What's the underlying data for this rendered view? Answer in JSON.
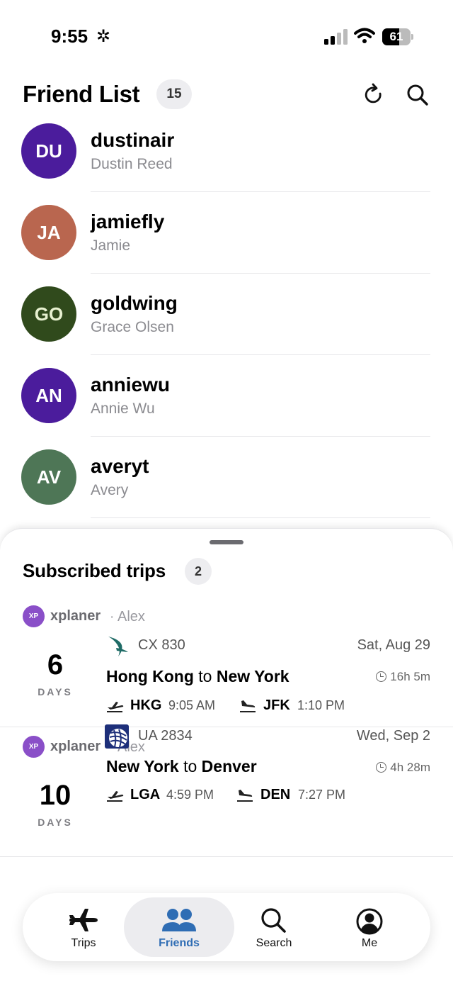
{
  "status_bar": {
    "time": "9:55",
    "battery_level": 61,
    "battery_text": "61"
  },
  "header": {
    "title": "Friend List",
    "count": "15"
  },
  "friends": [
    {
      "initials": "DU",
      "username": "dustinair",
      "name": "Dustin Reed",
      "color": "#4b1c9c"
    },
    {
      "initials": "JA",
      "username": "jamiefly",
      "name": "Jamie",
      "color": "#b9664f"
    },
    {
      "initials": "GO",
      "username": "goldwing",
      "name": "Grace Olsen",
      "color": "#304a1c"
    },
    {
      "initials": "AN",
      "username": "anniewu",
      "name": "Annie Wu",
      "color": "#4b1c9c"
    },
    {
      "initials": "AV",
      "username": "averyt",
      "name": "Avery",
      "color": "#4e7656"
    }
  ],
  "subscribed": {
    "title": "Subscribed trips",
    "count": "2",
    "trips": [
      {
        "owner_initials": "XP",
        "owner_username": "xplaner",
        "owner_separator": "·",
        "owner_name": "Alex",
        "days": "6",
        "days_label": "DAYS",
        "airline_logo": "cathay-pacific-logo",
        "flight_number": "CX 830",
        "date": "Sat, Aug 29",
        "origin_city": "Hong Kong",
        "to_word": "to",
        "destination_city": "New York",
        "duration": "16h 5m",
        "depart_code": "HKG",
        "depart_time": "9:05 AM",
        "arrive_code": "JFK",
        "arrive_time": "1:10 PM"
      },
      {
        "owner_initials": "XP",
        "owner_username": "xplaner",
        "owner_separator": "·",
        "owner_name": "Alex",
        "days": "10",
        "days_label": "DAYS",
        "airline_logo": "united-airlines-logo",
        "flight_number": "UA 2834",
        "date": "Wed, Sep 2",
        "origin_city": "New York",
        "to_word": "to",
        "destination_city": "Denver",
        "duration": "4h 28m",
        "depart_code": "LGA",
        "depart_time": "4:59 PM",
        "arrive_code": "DEN",
        "arrive_time": "7:27 PM"
      }
    ]
  },
  "tabs": [
    {
      "label": "Trips",
      "icon": "airplane-icon"
    },
    {
      "label": "Friends",
      "icon": "people-icon",
      "selected": true
    },
    {
      "label": "Search",
      "icon": "search-icon"
    },
    {
      "label": "Me",
      "icon": "person-circle-icon"
    }
  ],
  "colors": {
    "accent": "#2f6db4",
    "owner_avatar": "#8a4fc8",
    "secondary_text": "#8b8b90"
  }
}
